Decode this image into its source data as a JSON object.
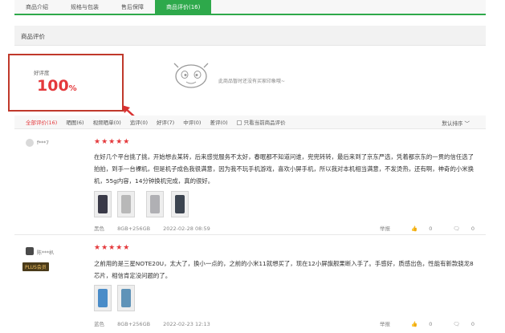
{
  "tabs": [
    {
      "label": "商品介绍"
    },
    {
      "label": "规格与包装"
    },
    {
      "label": "售后保障"
    },
    {
      "label": "商品评价(16)"
    }
  ],
  "section_title": "商品评价",
  "rating": {
    "label": "好评度",
    "value": "100",
    "unit": "%"
  },
  "empty_note": "此商品暂时还没有买家印象哦~",
  "filters": [
    {
      "label": "全部评价(16)"
    },
    {
      "label": "晒图(6)"
    },
    {
      "label": "视频晒单(0)"
    },
    {
      "label": "追评(0)"
    },
    {
      "label": "好评(7)"
    },
    {
      "label": "中评(0)"
    },
    {
      "label": "差评(0)"
    }
  ],
  "only_current_label": "只看当前商品评价",
  "sort_label": "默认排序",
  "reviews": [
    {
      "user": "f***7",
      "stars": "★★★★★",
      "text": "在好几个平台挑了挑，开始想去某转，后来感觉服务不太好，春眠都不知道问谁，兜兜转转，最后来到了京东严选，凭着都京东的一贯的信任选了拍拍，到手一台裸机，但是机子成色我很满意，因为我不玩手机游戏，喜欢小屏手机，所以我对本机相当满意，不发烫热，还有啊，神奇的小米换机，55g内容，14分钟换机完成，真的很好。",
      "color": "黑色",
      "spec": "8GB+256GB",
      "date": "2022-02-28 08:59",
      "report": "举报",
      "likes": "0",
      "comments": "0"
    },
    {
      "user": "陈***朳",
      "badge": "PLUS会员",
      "stars": "★★★★★",
      "text": "之前用的是三星NOTE20U，太大了，换小一点的，之前的小米11就想买了，现在12小屏旗舰果断入手了。手感好，质感出色，性能有新款骁龙8芯片，相信肯定没问题的了。",
      "color": "蓝色",
      "spec": "8GB+256GB",
      "date": "2022-02-23 12:13",
      "report": "举报",
      "likes": "0",
      "comments": "0"
    }
  ]
}
